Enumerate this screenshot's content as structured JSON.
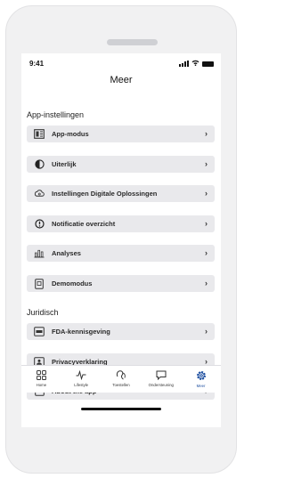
{
  "status": {
    "time": "9:41"
  },
  "header": {
    "title": "Meer"
  },
  "sections": [
    {
      "heading": "App-instellingen",
      "items": [
        {
          "label": "App-modus",
          "icon": "app-mode-icon"
        },
        {
          "label": "Uiterlijk",
          "icon": "contrast-icon"
        },
        {
          "label": "Instellingen Digitale Oplossingen",
          "icon": "cloud-settings-icon"
        },
        {
          "label": "Notificatie overzicht",
          "icon": "notification-icon"
        },
        {
          "label": "Analyses",
          "icon": "analytics-icon"
        },
        {
          "label": "Demomodus",
          "icon": "demo-icon"
        }
      ]
    },
    {
      "heading": "Juridisch",
      "items": [
        {
          "label": "FDA-kennisgeving",
          "icon": "fda-icon"
        },
        {
          "label": "Privacyverklaring",
          "icon": "privacy-icon"
        },
        {
          "label": "About the app",
          "icon": "info-icon"
        }
      ]
    }
  ],
  "tabbar": {
    "tabs": [
      {
        "label": "Home",
        "icon": "home-icon",
        "active": false
      },
      {
        "label": "Lifestyle",
        "icon": "lifestyle-icon",
        "active": false
      },
      {
        "label": "Toestellen",
        "icon": "devices-icon",
        "active": false
      },
      {
        "label": "Ondersteuning",
        "icon": "support-icon",
        "active": false
      },
      {
        "label": "Meer",
        "icon": "gear-icon",
        "active": true
      }
    ]
  },
  "colors": {
    "accent": "#1e4fa0",
    "item_background": "#e9e9ec",
    "device_frame": "#f1f1f2"
  }
}
